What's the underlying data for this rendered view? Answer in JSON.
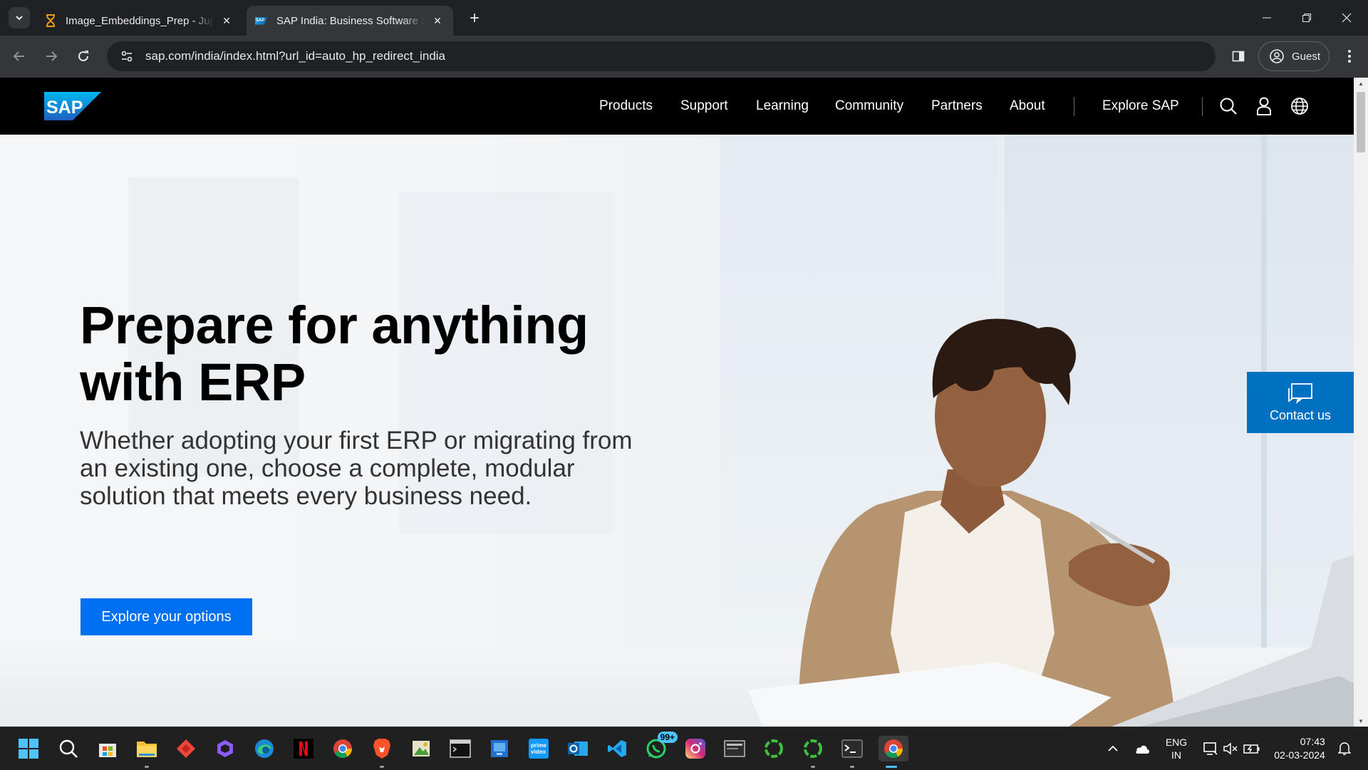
{
  "browser": {
    "tabs": [
      {
        "title": "Image_Embeddings_Prep - Jupy",
        "favicon": "hourglass-icon",
        "active": false
      },
      {
        "title": "SAP India: Business Software So",
        "favicon": "sap-favicon",
        "active": true
      }
    ],
    "url": "sap.com/india/index.html?url_id=auto_hp_redirect_india",
    "profile_label": "Guest"
  },
  "site": {
    "logo_text": "SAP",
    "nav": [
      "Products",
      "Support",
      "Learning",
      "Community",
      "Partners",
      "About"
    ],
    "explore": "Explore SAP"
  },
  "hero": {
    "headline": "Prepare for anything with ERP",
    "subhead": "Whether adopting your first ERP or migrating from an existing one, choose a complete, modular solution that meets every business need.",
    "cta": "Explore your options"
  },
  "contact": {
    "label": "Contact us"
  },
  "colors": {
    "accent": "#0070f2",
    "contact": "#0070c0",
    "header": "#000000"
  },
  "taskbar": {
    "apps": [
      "windows-start",
      "search",
      "microsoft-store",
      "file-explorer",
      "anydesk",
      "copilot",
      "edge",
      "netflix",
      "chrome",
      "brave",
      "image-editor",
      "terminal",
      "windows-app",
      "prime-video",
      "outlook",
      "vscode",
      "whatsapp",
      "instagram",
      "window-manager",
      "circle-app",
      "circle-app",
      "terminal",
      "chrome"
    ],
    "whatsapp_badge": "99+",
    "lang_line1": "ENG",
    "lang_line2": "IN",
    "time": "07:43",
    "date": "02-03-2024"
  }
}
